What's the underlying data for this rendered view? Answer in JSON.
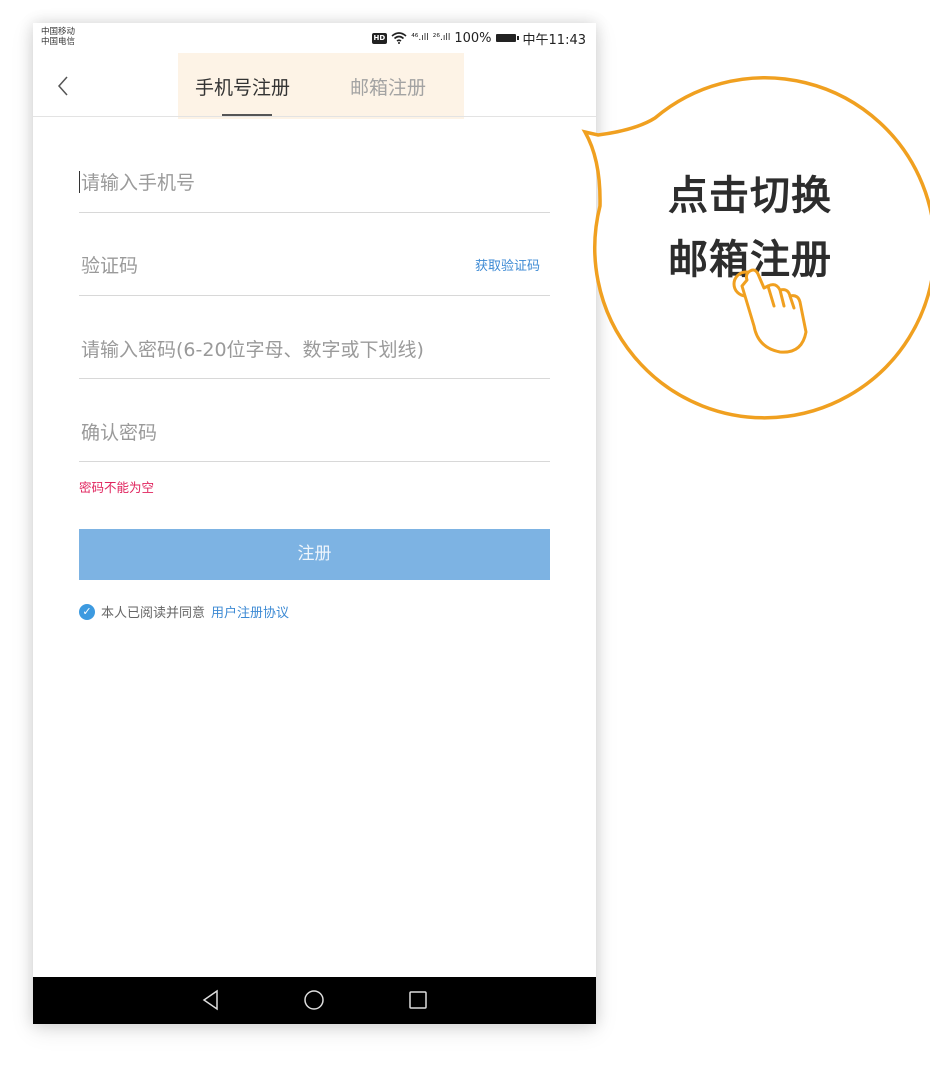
{
  "status_bar": {
    "carrier_1": "中国移动",
    "carrier_2": "中国电信",
    "hd": "HD",
    "signal_1": "⁴⁶.ıll",
    "signal_2": "²⁶.ıll",
    "battery_percent": "100%",
    "time": "中午11:43"
  },
  "header": {
    "back_label": "〈",
    "tabs": [
      {
        "label": "手机号注册",
        "active": true
      },
      {
        "label": "邮箱注册",
        "active": false
      }
    ]
  },
  "form": {
    "phone_placeholder": "请输入手机号",
    "code_placeholder": "验证码",
    "get_code_label": "获取验证码",
    "password_placeholder": "请输入密码(6-20位字母、数字或下划线)",
    "confirm_placeholder": "确认密码",
    "error_message": "密码不能为空",
    "submit_label": "注册",
    "agree_text": "本人已阅读并同意",
    "agree_link": "用户注册协议"
  },
  "callout": {
    "line_1": "点击切换",
    "line_2": "邮箱注册"
  },
  "icons": {
    "check": "checkmark-icon",
    "back": "chevron-left-icon",
    "pointer": "hand-pointer-icon"
  },
  "colors": {
    "accent": "#7db3e3",
    "link": "#3d8ad4",
    "error": "#e0245e",
    "callout_border": "#f0a020"
  }
}
